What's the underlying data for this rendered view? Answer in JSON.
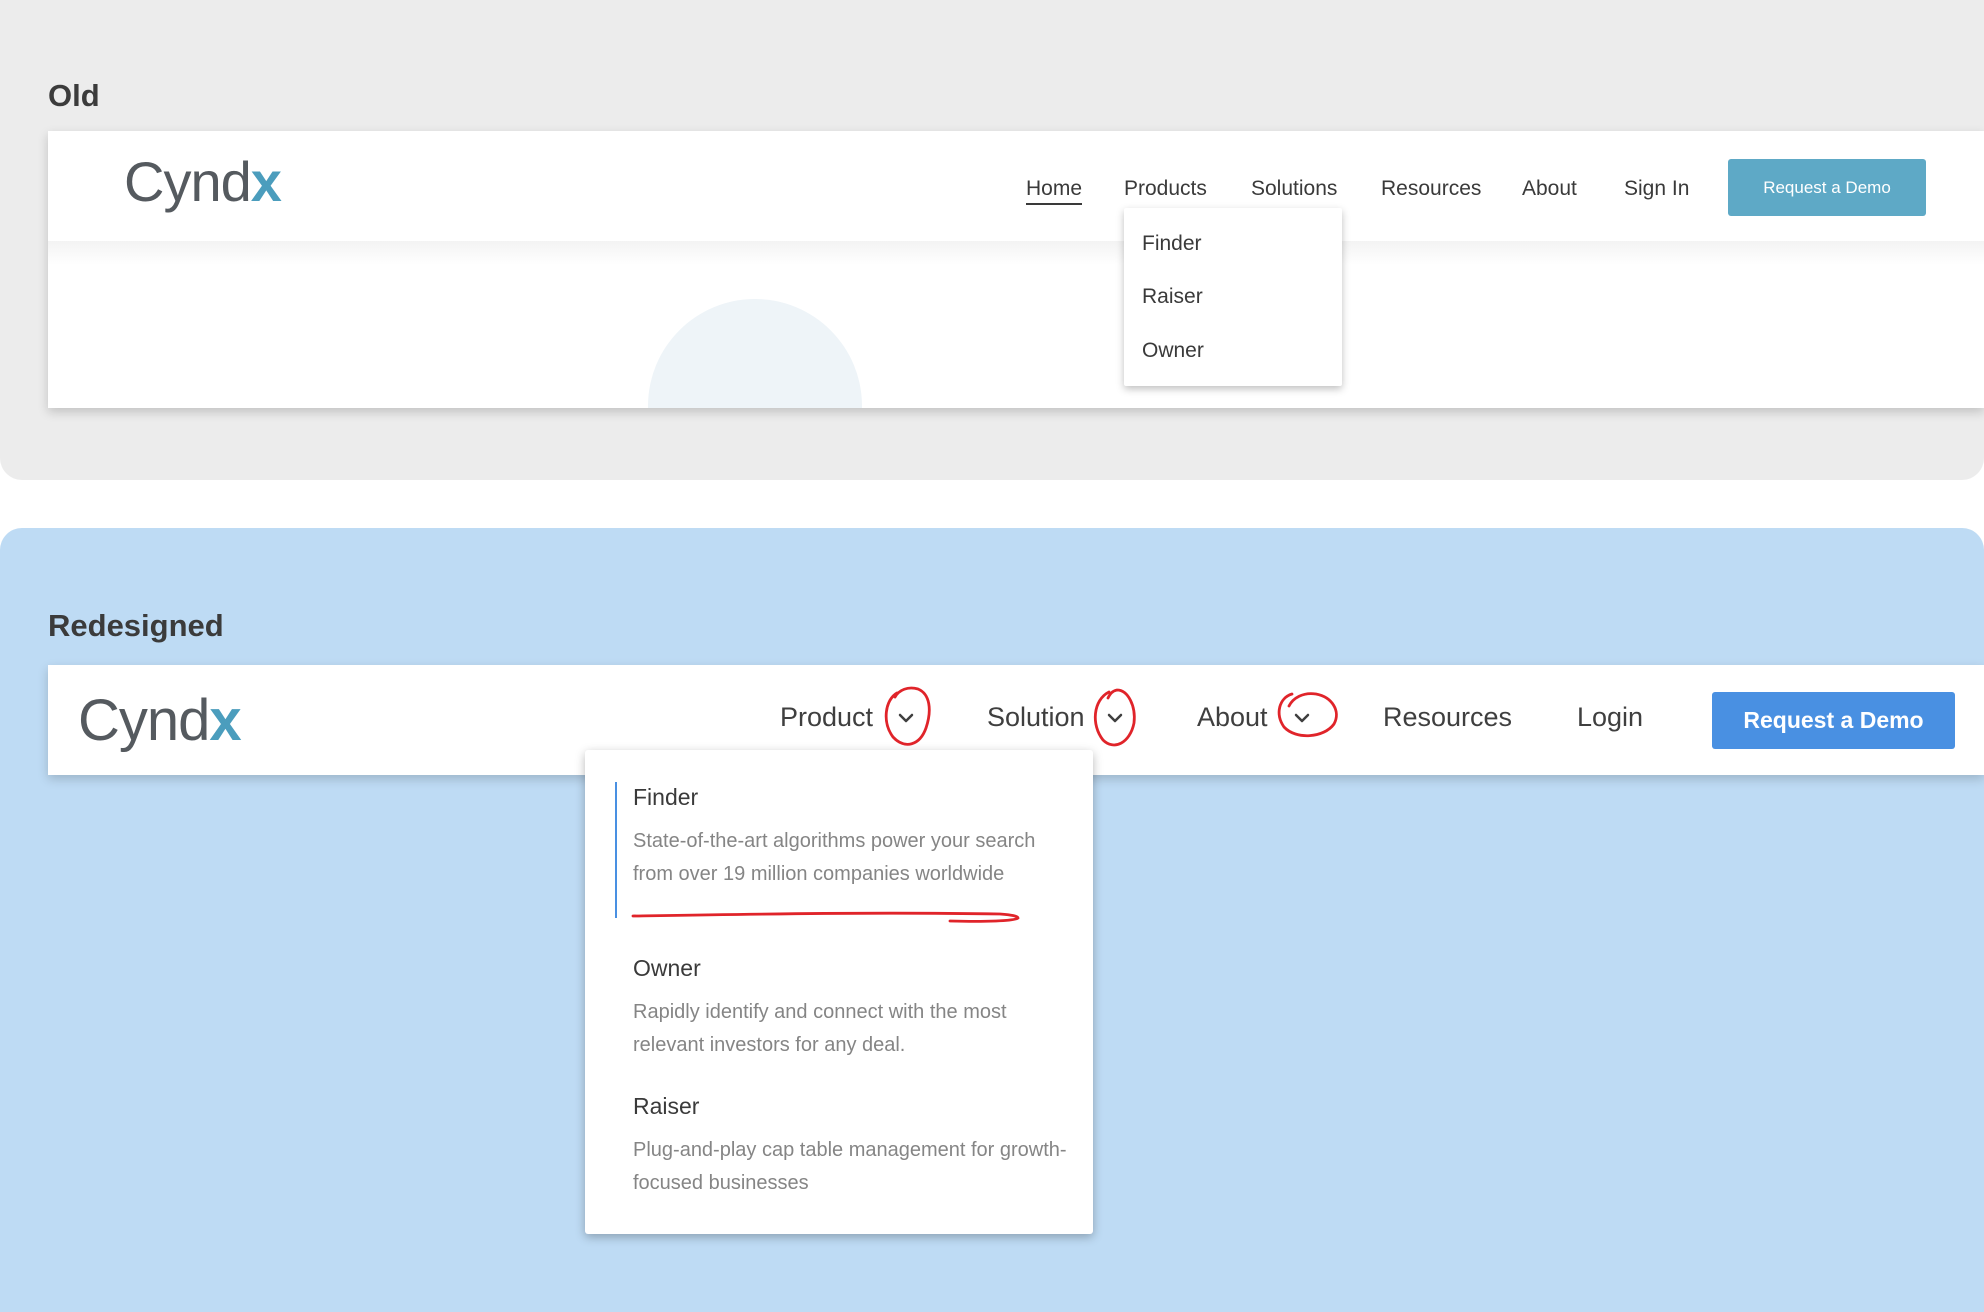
{
  "old": {
    "label": "Old",
    "logo": {
      "text": "Cynd",
      "accent": "x"
    },
    "nav": [
      "Home",
      "Products",
      "Solutions",
      "Resources",
      "About",
      "Sign In"
    ],
    "active": "Home",
    "cta": "Request a Demo",
    "dropdown": [
      "Finder",
      "Raiser",
      "Owner"
    ]
  },
  "redesigned": {
    "label": "Redesigned",
    "logo": {
      "text": "Cynd",
      "accent": "x"
    },
    "nav": [
      "Product",
      "Solution",
      "About",
      "Resources",
      "Login"
    ],
    "cta": "Request a Demo",
    "dropdown": [
      {
        "title": "Finder",
        "desc": "State-of-the-art algorithms power your search from over 19 million companies worldwide"
      },
      {
        "title": "Owner",
        "desc": "Rapidly identify and connect with the most relevant investors for any deal."
      },
      {
        "title": "Raiser",
        "desc": "Plug-and-play cap table management for growth-focused businesses"
      }
    ]
  },
  "colors": {
    "old_bg": "#ececec",
    "new_bg": "#bedbf4",
    "old_cta": "#5ea9c6",
    "new_cta": "#4990e2",
    "logo_accent": "#4b9dbd",
    "annotation": "#e0242a"
  },
  "icons": [
    "chevron-down-icon"
  ]
}
